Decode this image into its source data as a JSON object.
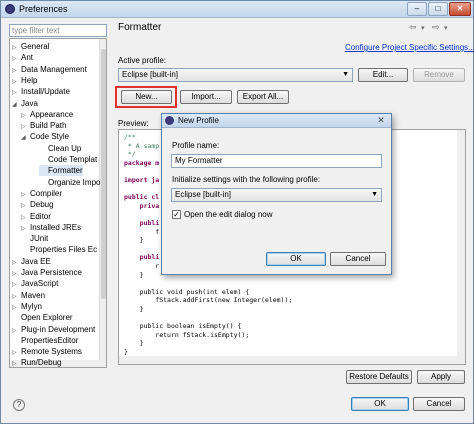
{
  "window": {
    "title": "Preferences",
    "title_btn_min": "–",
    "title_btn_max": "□",
    "title_btn_close": "✕"
  },
  "filter": {
    "placeholder": "type filter text"
  },
  "tree": [
    {
      "label": "General",
      "exp": "▷"
    },
    {
      "label": "Ant",
      "exp": "▷"
    },
    {
      "label": "Data Management",
      "exp": "▷"
    },
    {
      "label": "Help",
      "exp": "▷"
    },
    {
      "label": "Install/Update",
      "exp": "▷"
    },
    {
      "label": "Java",
      "exp": "◢"
    },
    {
      "label": "Appearance",
      "exp": "▷"
    },
    {
      "label": "Build Path",
      "exp": "▷"
    },
    {
      "label": "Code Style",
      "exp": "◢"
    },
    {
      "label": "Clean Up",
      "exp": ""
    },
    {
      "label": "Code Templat",
      "exp": ""
    },
    {
      "label": "Formatter",
      "exp": ""
    },
    {
      "label": "Organize Impo",
      "exp": ""
    },
    {
      "label": "Compiler",
      "exp": "▷"
    },
    {
      "label": "Debug",
      "exp": "▷"
    },
    {
      "label": "Editor",
      "exp": "▷"
    },
    {
      "label": "Installed JREs",
      "exp": "▷"
    },
    {
      "label": "JUnit",
      "exp": ""
    },
    {
      "label": "Properties Files Ec",
      "exp": ""
    },
    {
      "label": "Java EE",
      "exp": "▷"
    },
    {
      "label": "Java Persistence",
      "exp": "▷"
    },
    {
      "label": "JavaScript",
      "exp": "▷"
    },
    {
      "label": "Maven",
      "exp": "▷"
    },
    {
      "label": "Mylyn",
      "exp": "▷"
    },
    {
      "label": "Open Explorer",
      "exp": ""
    },
    {
      "label": "Plug-in Development",
      "exp": "▷"
    },
    {
      "label": "PropertiesEditor",
      "exp": ""
    },
    {
      "label": "Remote Systems",
      "exp": "▷"
    },
    {
      "label": "Run/Debug",
      "exp": "▷"
    }
  ],
  "page": {
    "title": "Formatter",
    "nav_back": "⇦",
    "nav_fwd": "⇨",
    "nav_menu": "▾",
    "config_link": "Configure Project Specific Settings...",
    "active_profile_label": "Active profile:",
    "active_profile_value": "Eclipse [built-in]",
    "edit_btn": "Edit...",
    "remove_btn": "Remove",
    "new_btn": "New...",
    "import_btn": "Import...",
    "export_btn": "Export All...",
    "preview_label": "Preview:",
    "restore_btn": "Restore Defaults",
    "apply_btn": "Apply",
    "ok_btn": "OK",
    "cancel_btn": "Cancel",
    "help": "?"
  },
  "code": [
    {
      "t": "/**",
      "c": "cm"
    },
    {
      "t": " * A samp",
      "c": "cm"
    },
    {
      "t": " */",
      "c": "cm"
    },
    {
      "t": "package m",
      "c": "kw"
    },
    {
      "t": "",
      "c": ""
    },
    {
      "t": "import ja",
      "c": "kw"
    },
    {
      "t": "",
      "c": ""
    },
    {
      "t": "public cl",
      "c": "kw"
    },
    {
      "t": "    priva",
      "c": "kw"
    },
    {
      "t": "",
      "c": ""
    },
    {
      "t": "    publi",
      "c": "kw"
    },
    {
      "t": "        f",
      "c": ""
    },
    {
      "t": "    }",
      "c": ""
    },
    {
      "t": "",
      "c": ""
    },
    {
      "t": "    publi",
      "c": "kw"
    },
    {
      "t": "        r",
      "c": ""
    },
    {
      "t": "    }",
      "c": ""
    },
    {
      "t": "",
      "c": ""
    },
    {
      "t": "    public void push(int elem) {",
      "c": ""
    },
    {
      "t": "        fStack.addFirst(new Integer(elem));",
      "c": ""
    },
    {
      "t": "    }",
      "c": ""
    },
    {
      "t": "",
      "c": ""
    },
    {
      "t": "    public boolean isEmpty() {",
      "c": ""
    },
    {
      "t": "        return fStack.isEmpty();",
      "c": ""
    },
    {
      "t": "    }",
      "c": ""
    },
    {
      "t": "}",
      "c": ""
    }
  ],
  "dialog": {
    "title": "New Profile",
    "close": "✕",
    "name_label": "Profile name:",
    "name_value": "My Formatter",
    "init_label": "Initialize settings with the following profile:",
    "init_value": "Eclipse [built-in]",
    "open_edit_label": "Open the edit dialog now",
    "open_edit_checked": true,
    "check_mark": "✓",
    "ok_btn": "OK",
    "cancel_btn": "Cancel"
  },
  "colors": {
    "highlight_box": "#e03030",
    "link": "#0033cc"
  },
  "icons": {
    "combo_arrow": "▼"
  }
}
